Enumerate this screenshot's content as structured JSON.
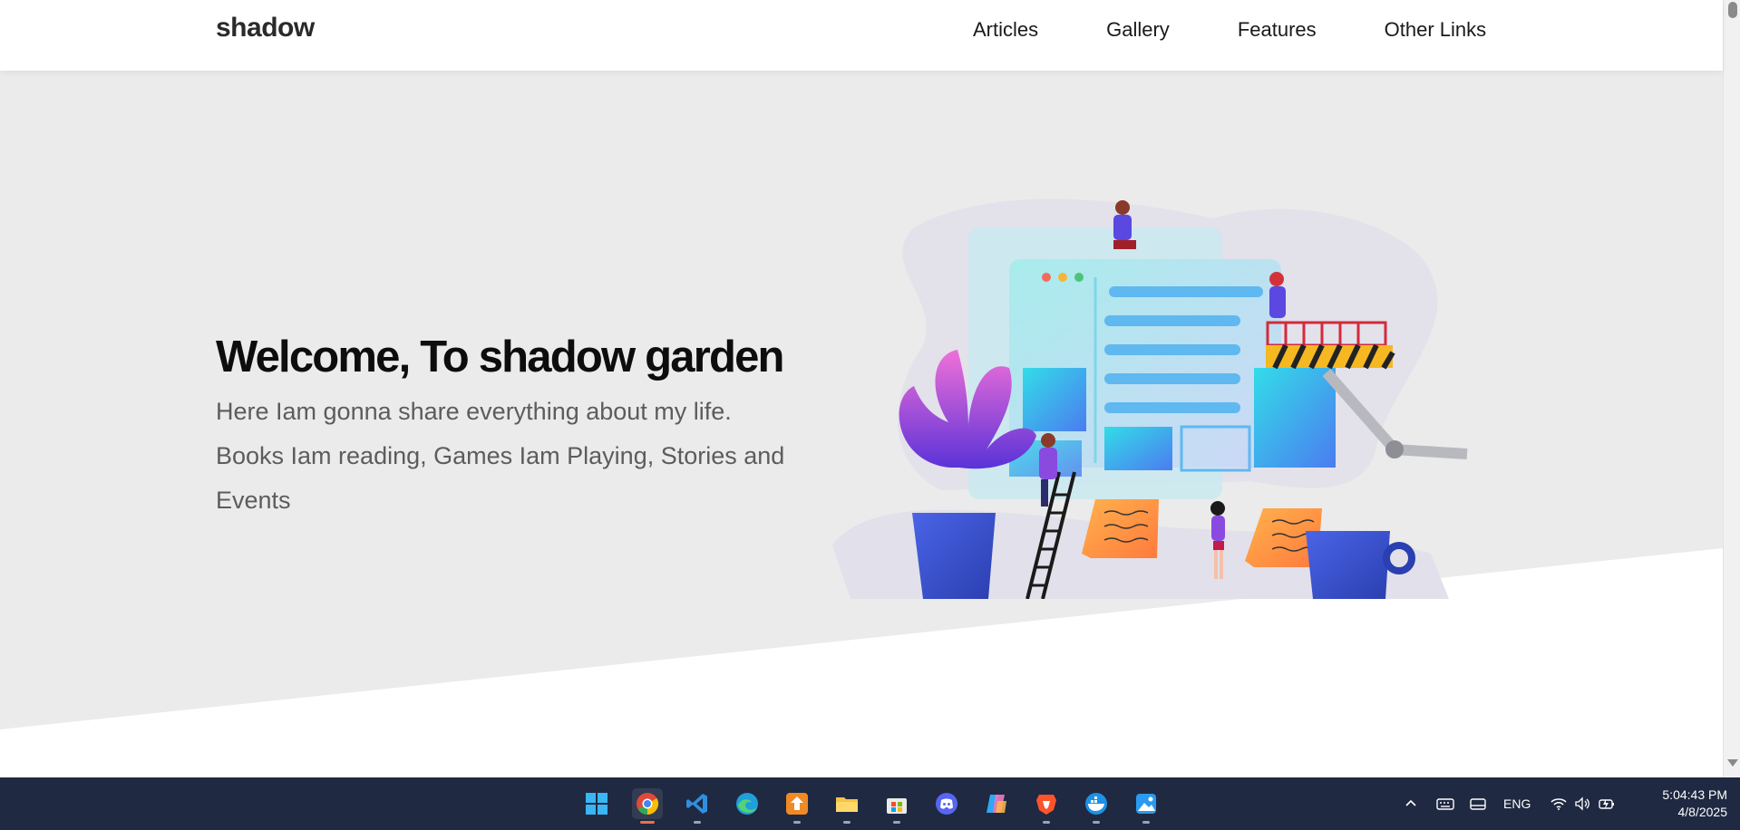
{
  "header": {
    "logo": "shadow",
    "nav": [
      "Articles",
      "Gallery",
      "Features",
      "Other Links"
    ]
  },
  "hero": {
    "title": "Welcome, To shadow garden",
    "text": "Here Iam gonna share everything about my life. Books Iam reading, Games Iam Playing, Stories and Events",
    "illustration": "website-builders-illustration",
    "scroll_icon": "double-chevron-down-icon"
  },
  "taskbar": {
    "apps": [
      "windows-start-icon",
      "chrome-icon",
      "vscode-icon",
      "edge-icon",
      "app-icon",
      "file-explorer-icon",
      "microsoft-store-icon",
      "discord-icon",
      "copilot-icon",
      "brave-icon",
      "docker-icon",
      "photos-icon"
    ],
    "language": "ENG",
    "time": "5:04:43 PM",
    "date": "4/8/2025"
  },
  "colors": {
    "hero_bg": "#ebebeb",
    "taskbar_bg": "#1f2942",
    "accent": "#f0704a"
  }
}
